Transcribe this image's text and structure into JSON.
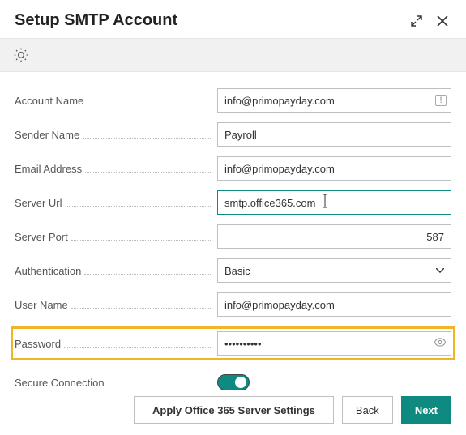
{
  "title": "Setup SMTP Account",
  "fields": {
    "account_name": {
      "label": "Account Name",
      "value": "info@primopayday.com"
    },
    "sender_name": {
      "label": "Sender Name",
      "value": "Payroll"
    },
    "email_address": {
      "label": "Email Address",
      "value": "info@primopayday.com"
    },
    "server_url": {
      "label": "Server Url",
      "value": "smtp.office365.com"
    },
    "server_port": {
      "label": "Server Port",
      "value": "587"
    },
    "authentication": {
      "label": "Authentication",
      "value": "Basic"
    },
    "user_name": {
      "label": "User Name",
      "value": "info@primopayday.com"
    },
    "password": {
      "label": "Password",
      "value": "••••••••••"
    },
    "secure_connection": {
      "label": "Secure Connection"
    }
  },
  "buttons": {
    "apply": "Apply Office 365 Server Settings",
    "back": "Back",
    "next": "Next"
  }
}
